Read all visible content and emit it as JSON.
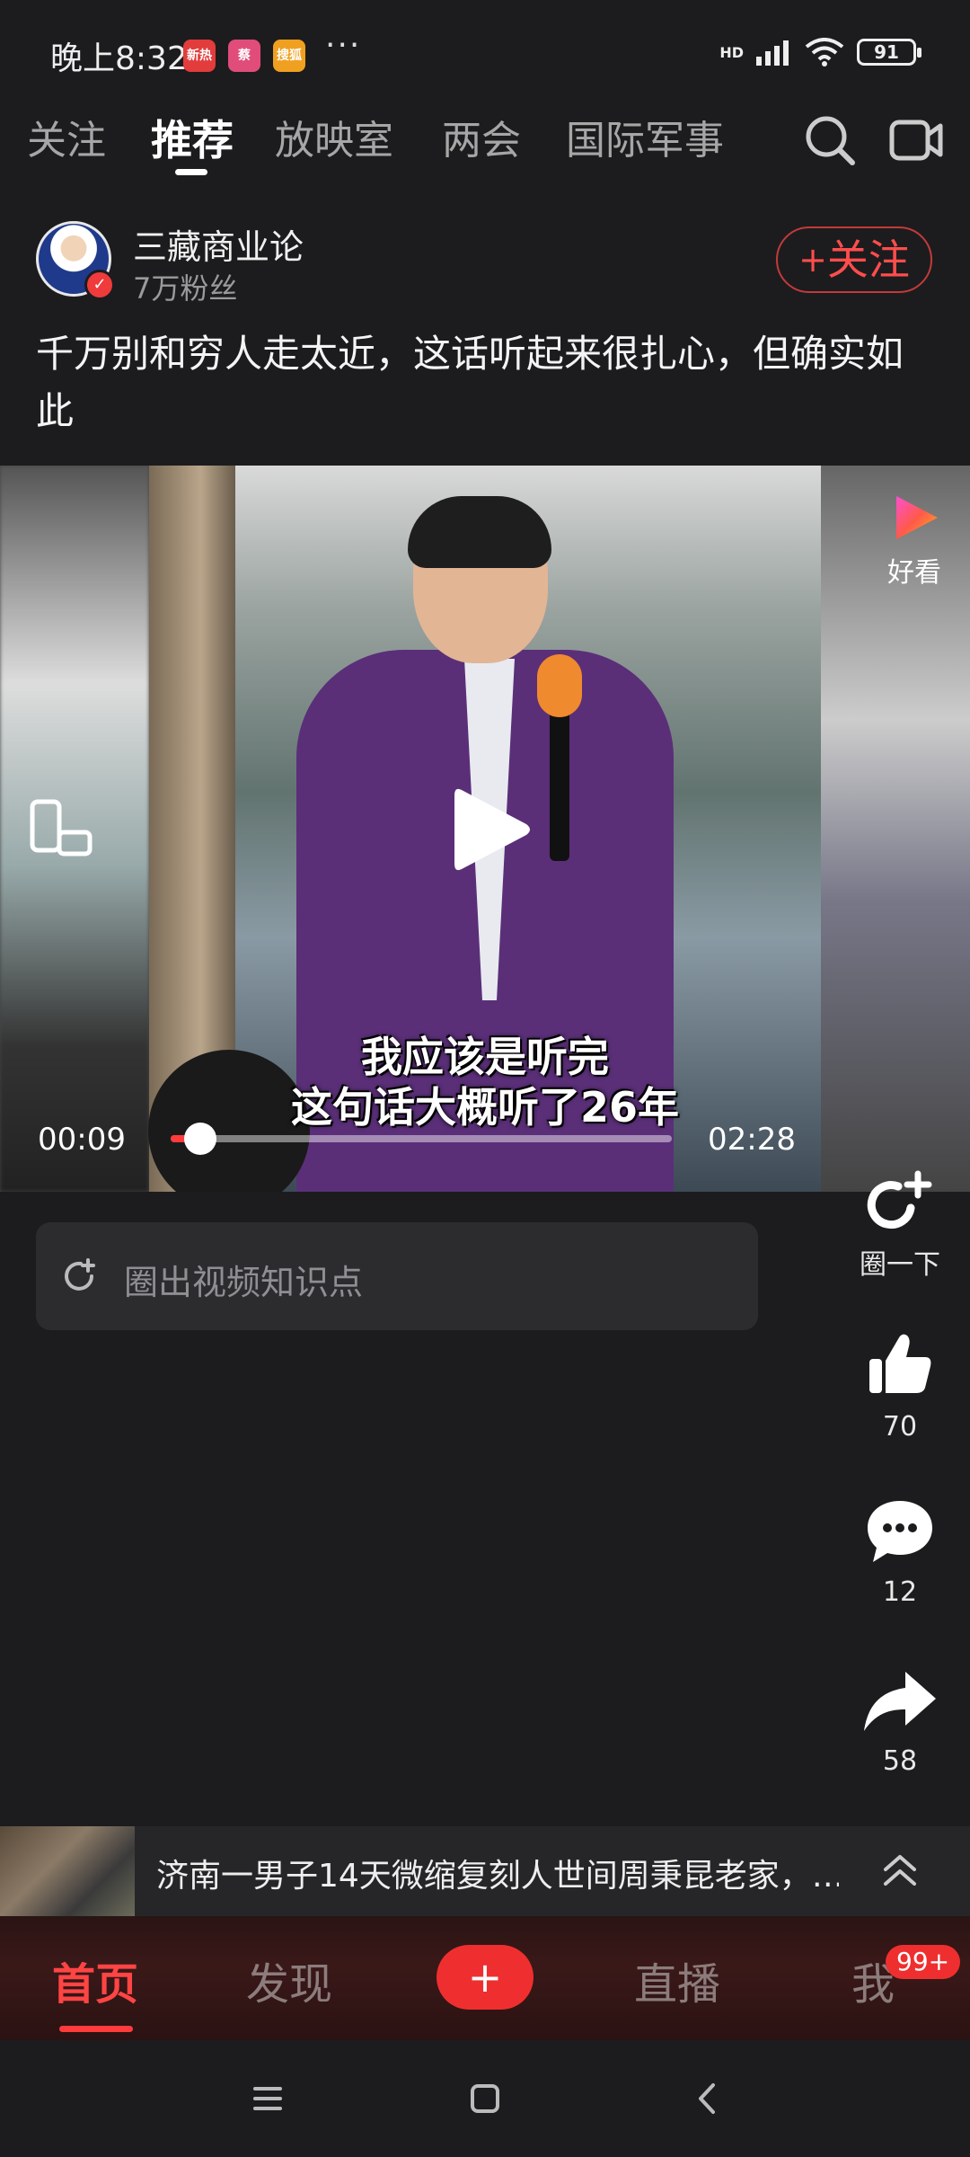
{
  "status_bar": {
    "time": "晚上8:32",
    "apps": [
      {
        "label": "新热",
        "color": "#e23c3c"
      },
      {
        "label": "蔡",
        "color": "#e04d7a"
      },
      {
        "label": "搜狐",
        "color": "#f0a020"
      }
    ],
    "more": "···",
    "network": "HD",
    "battery": "91"
  },
  "top_nav": {
    "tabs": [
      "关注",
      "推荐",
      "放映室",
      "两会",
      "国际军事"
    ],
    "active_index": 1
  },
  "author": {
    "name": "三藏商业论",
    "fans": "7万粉丝",
    "follow_label": "关注",
    "follow_plus": "+"
  },
  "post": {
    "title": "千万别和穷人走太近，这话听起来很扎心，但确实如此"
  },
  "video": {
    "subtitle_line1": "我应该是听完",
    "subtitle_line2": "这句话大概听了26年",
    "current_time": "00:09",
    "total_time": "02:28",
    "progress": 0.06,
    "source_label": "好看"
  },
  "knowledge": {
    "placeholder": "圈出视频知识点"
  },
  "actions": {
    "circle_label": "圈一下",
    "likes": "70",
    "comments": "12",
    "shares": "58"
  },
  "ticker": {
    "text": "济南一男子14天微缩复刻人世间周秉昆老家，…"
  },
  "tabbar": {
    "home": "首页",
    "discover": "发现",
    "publish": "+",
    "live": "直播",
    "me": "我",
    "badge": "99+"
  },
  "colors": {
    "accent": "#ff3b3b",
    "background": "#1c1c1e"
  }
}
